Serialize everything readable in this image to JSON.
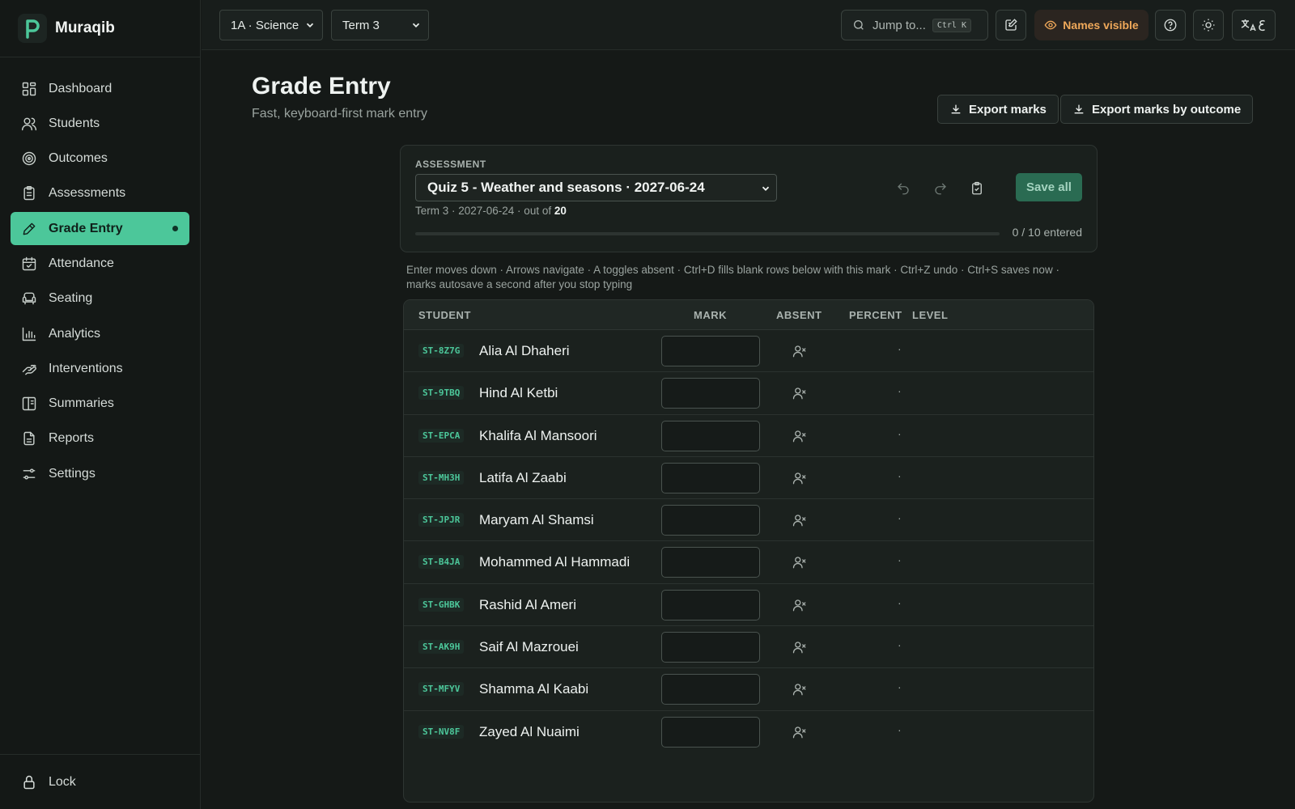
{
  "app": {
    "name": "Muraqib"
  },
  "sidebar": {
    "items": [
      {
        "label": "Dashboard",
        "icon": "dashboard-icon"
      },
      {
        "label": "Students",
        "icon": "students-icon"
      },
      {
        "label": "Outcomes",
        "icon": "target-icon"
      },
      {
        "label": "Assessments",
        "icon": "clipboard-icon"
      },
      {
        "label": "Grade Entry",
        "icon": "pen-icon",
        "active": true
      },
      {
        "label": "Attendance",
        "icon": "calendar-check-icon"
      },
      {
        "label": "Seating",
        "icon": "armchair-icon"
      },
      {
        "label": "Analytics",
        "icon": "bar-chart-icon"
      },
      {
        "label": "Interventions",
        "icon": "hand-heart-icon"
      },
      {
        "label": "Summaries",
        "icon": "book-icon"
      },
      {
        "label": "Reports",
        "icon": "file-text-icon"
      },
      {
        "label": "Settings",
        "icon": "sliders-icon"
      }
    ],
    "lock_label": "Lock"
  },
  "topbar": {
    "class_select": "1A · Science",
    "term_select": "Term 3",
    "jump_placeholder": "Jump to...",
    "jump_shortcut": "Ctrl K",
    "names_visible": "Names visible"
  },
  "page": {
    "title": "Grade Entry",
    "subtitle": "Fast, keyboard-first mark entry",
    "export_marks": "Export marks",
    "export_by_outcome": "Export marks by outcome"
  },
  "assessment": {
    "label": "ASSESSMENT",
    "selected": "Quiz 5 - Weather and seasons · 2027-06-24",
    "meta_prefix": "Term 3 · 2027-06-24 · out of",
    "out_of": "20",
    "save_all": "Save all",
    "progress_text": "0 / 10 entered",
    "progress_fraction": 0
  },
  "hint": "Enter moves down · Arrows navigate · A toggles absent · Ctrl+D fills blank rows below with this mark · Ctrl+Z undo · Ctrl+S saves now · marks autosave a second after you stop typing",
  "table": {
    "headers": {
      "student": "STUDENT",
      "mark": "MARK",
      "absent": "ABSENT",
      "percent": "PERCENT",
      "level": "LEVEL"
    },
    "rows": [
      {
        "id": "ST-8Z7G",
        "name": "Alia Al Dhaheri",
        "mark": "",
        "percent": "·",
        "level": ""
      },
      {
        "id": "ST-9TBQ",
        "name": "Hind Al Ketbi",
        "mark": "",
        "percent": "·",
        "level": ""
      },
      {
        "id": "ST-EPCA",
        "name": "Khalifa Al Mansoori",
        "mark": "",
        "percent": "·",
        "level": ""
      },
      {
        "id": "ST-MH3H",
        "name": "Latifa Al Zaabi",
        "mark": "",
        "percent": "·",
        "level": ""
      },
      {
        "id": "ST-JPJR",
        "name": "Maryam Al Shamsi",
        "mark": "",
        "percent": "·",
        "level": ""
      },
      {
        "id": "ST-B4JA",
        "name": "Mohammed Al Hammadi",
        "mark": "",
        "percent": "·",
        "level": ""
      },
      {
        "id": "ST-GHBK",
        "name": "Rashid Al Ameri",
        "mark": "",
        "percent": "·",
        "level": ""
      },
      {
        "id": "ST-AK9H",
        "name": "Saif Al Mazrouei",
        "mark": "",
        "percent": "·",
        "level": ""
      },
      {
        "id": "ST-MFYV",
        "name": "Shamma Al Kaabi",
        "mark": "",
        "percent": "·",
        "level": ""
      },
      {
        "id": "ST-NV8F",
        "name": "Zayed Al Nuaimi",
        "mark": "",
        "percent": "·",
        "level": ""
      }
    ]
  },
  "colors": {
    "accent": "#4cc79a",
    "warning": "#f0a95a",
    "background": "#151917"
  }
}
